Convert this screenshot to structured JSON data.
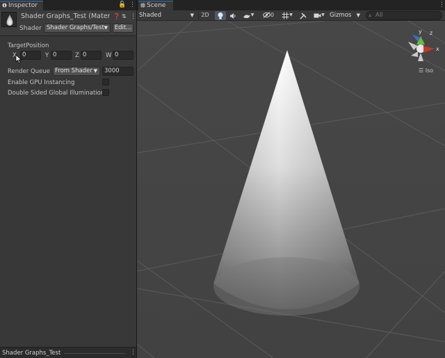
{
  "inspector": {
    "tab_label": "Inspector",
    "lock_glyph": "🔓",
    "menu_glyph": "⋮",
    "material_name": "Shader Graphs_Test (Material)",
    "help_glyph": "❓",
    "settings_glyph": "⇅",
    "header_menu_glyph": "⋮",
    "shader_label": "Shader",
    "shader_value": "Shader Graphs/Test",
    "edit_label": "Edit...",
    "props": {
      "target_position_label": "TargetPosition",
      "x_label": "X",
      "y_label": "Y",
      "z_label": "Z",
      "w_label": "W",
      "x_value": "0",
      "y_value": "0",
      "z_value": "0",
      "w_value": "0"
    },
    "render_queue_label": "Render Queue",
    "render_queue_mode": "From Shader",
    "render_queue_value": "3000",
    "gpu_instancing_label": "Enable GPU Instancing",
    "double_sided_gi_label": "Double Sided Global Illumination",
    "gpu_instancing_checked": false,
    "double_sided_gi_checked": false,
    "preview_name": "Shader Graphs_Test",
    "preview_menu_glyph": "⋮"
  },
  "scene": {
    "tab_label": "Scene",
    "menu_glyph": "⋮",
    "draw_mode": "Shaded",
    "mode_2d": "2D",
    "hidden_count": "0",
    "gizmos_label": "Gizmos",
    "search_placeholder": "All",
    "projection_label": "Iso",
    "axis_x": "x",
    "axis_y": "y",
    "axis_z": "z"
  },
  "colors": {
    "accent_tab": "#3a79bb",
    "axis_x": "#c0392b",
    "axis_y": "#6fb93a",
    "axis_z": "#3b6fcc"
  },
  "icons": [
    "info-icon",
    "lock-icon",
    "kebab-menu-icon",
    "help-icon",
    "preset-icon",
    "grid-icon",
    "light-icon",
    "audio-icon",
    "effects-icon",
    "visibility-icon",
    "grid-snap-icon",
    "tools-icon",
    "camera-icon",
    "search-icon",
    "scene-gizmo"
  ]
}
